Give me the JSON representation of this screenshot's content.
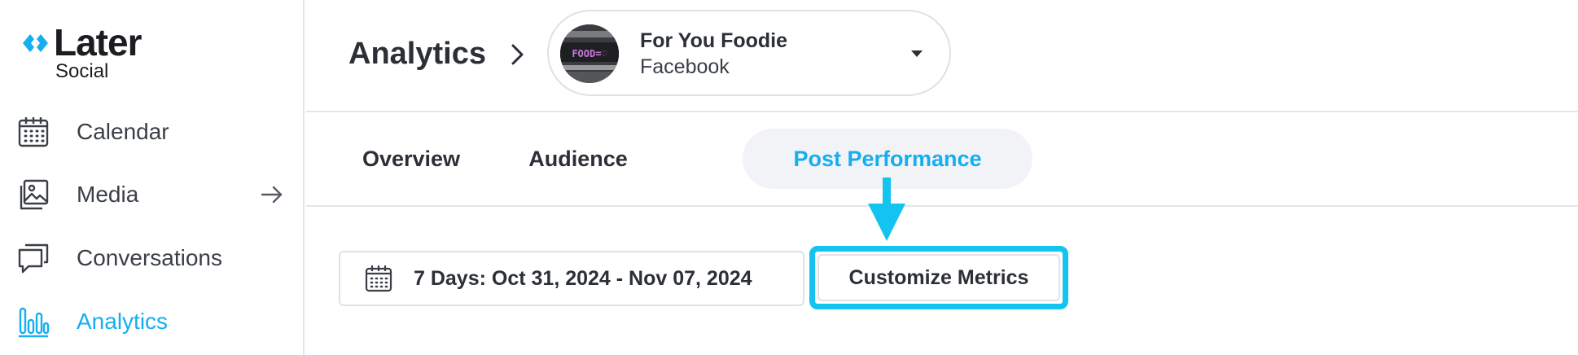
{
  "brand": {
    "name": "Later",
    "product": "Social",
    "accent_color": "#15aef0",
    "highlight_color": "#12c4ef"
  },
  "sidebar": {
    "items": [
      {
        "label": "Calendar",
        "icon": "calendar-icon",
        "active": false
      },
      {
        "label": "Media",
        "icon": "image-icon",
        "active": false,
        "trailing_icon": "arrow-right-icon"
      },
      {
        "label": "Conversations",
        "icon": "chat-bubbles-icon",
        "active": false
      },
      {
        "label": "Analytics",
        "icon": "bar-chart-icon",
        "active": true
      }
    ]
  },
  "header": {
    "title": "Analytics",
    "breadcrumb_icon": "chevron-right-icon",
    "account": {
      "name": "For You Foodie",
      "platform": "Facebook",
      "avatar_text": "FOOD=♡",
      "dropdown_icon": "caret-down-icon"
    }
  },
  "tabs": [
    {
      "label": "Overview",
      "active": false
    },
    {
      "label": "Audience",
      "active": false
    },
    {
      "label": "Post Performance",
      "active": true
    }
  ],
  "toolbar": {
    "date_range_label": "7 Days: Oct 31, 2024 - Nov 07, 2024",
    "date_icon": "calendar-icon",
    "customize_label": "Customize Metrics"
  }
}
